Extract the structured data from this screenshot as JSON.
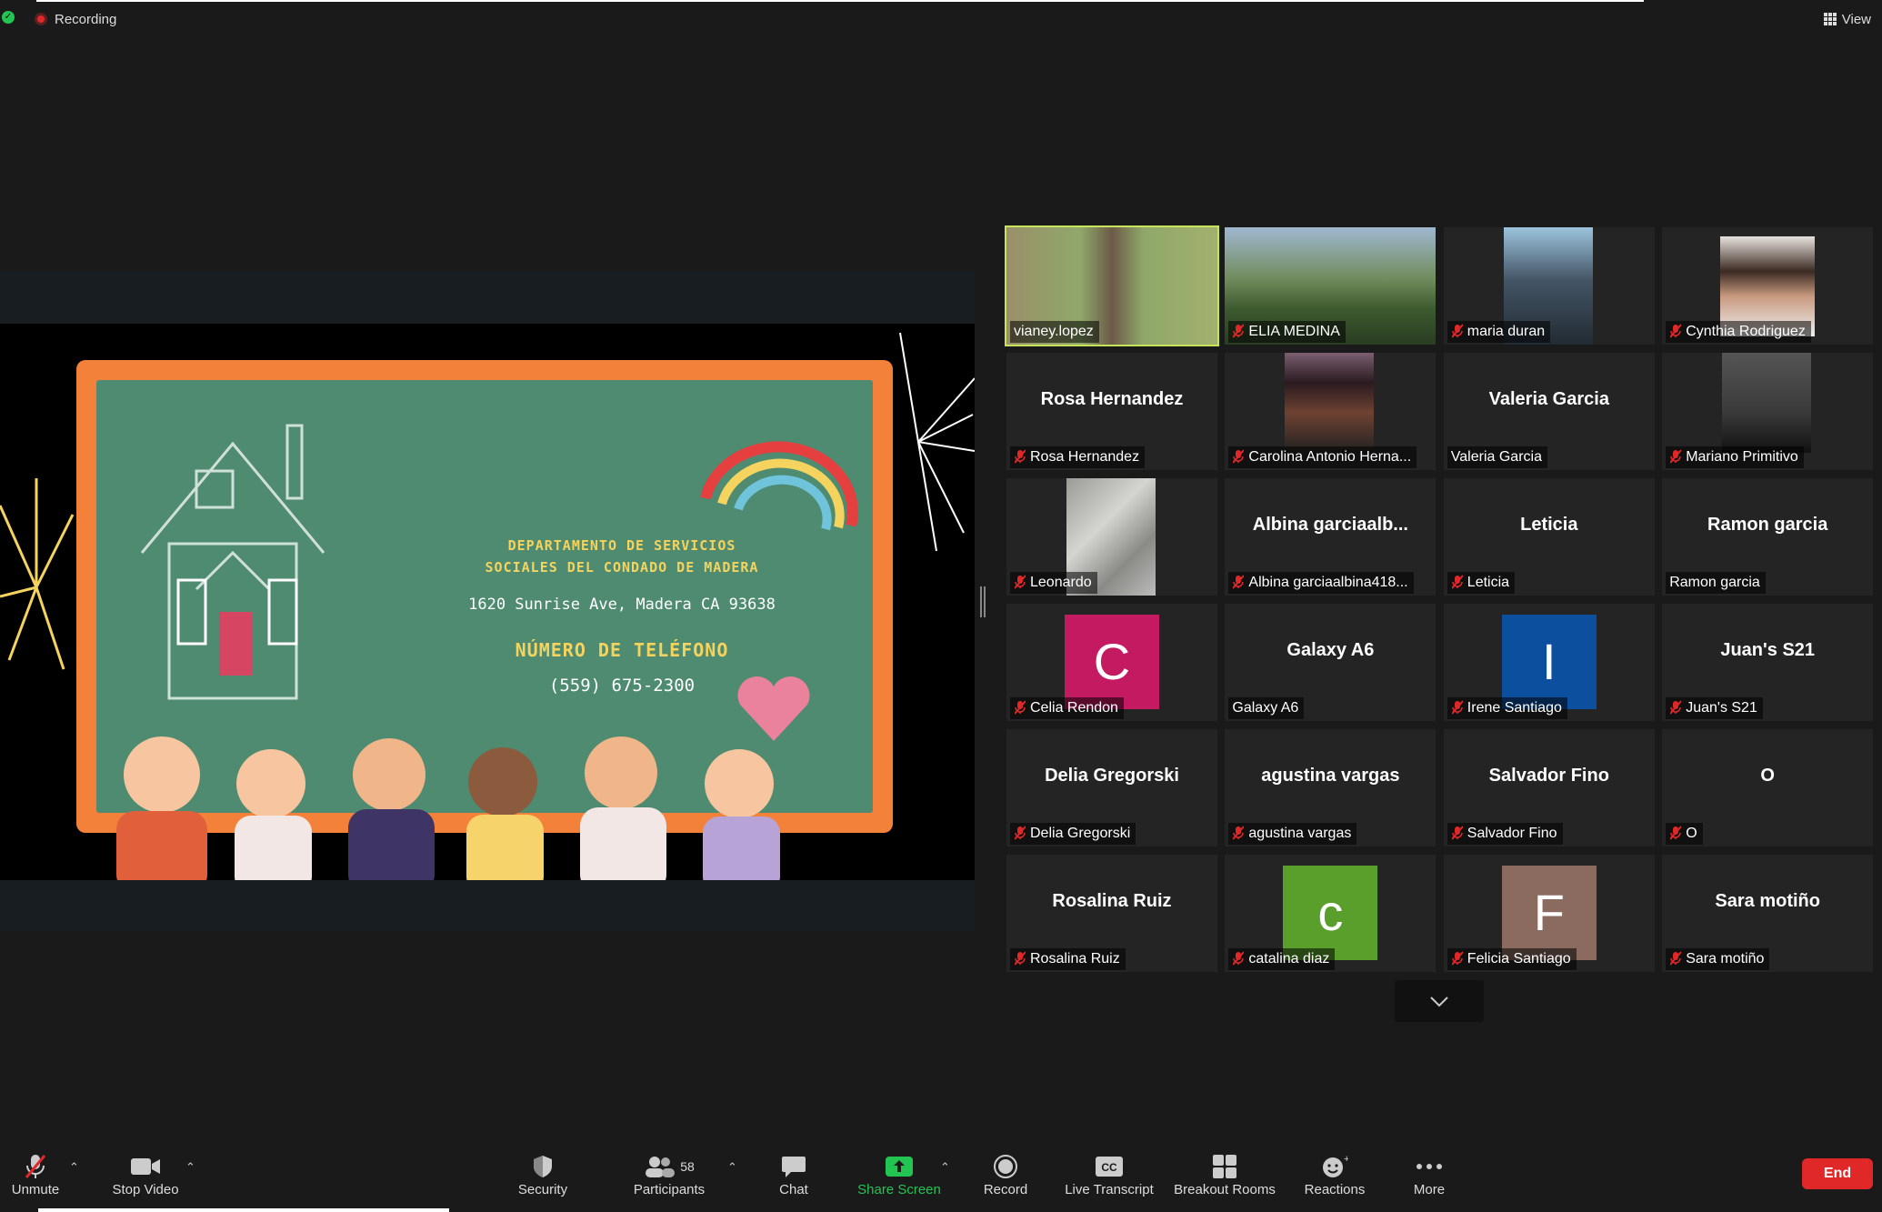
{
  "topbar": {
    "recording_label": "Recording",
    "view_label": "View"
  },
  "slide": {
    "dept_line1": "DEPARTAMENTO DE SERVICIOS",
    "dept_line2": "SOCIALES DEL CONDADO DE MADERA",
    "address": "1620 Sunrise Ave, Madera CA 93638",
    "phone_label": "NÚMERO DE TELÉFONO",
    "phone": "(559) 675-2300"
  },
  "participants": [
    {
      "name": "vianey.lopez",
      "muted": false,
      "active": true,
      "video": "cam-a"
    },
    {
      "name": "ELIA MEDINA",
      "muted": true,
      "video": "cam-b"
    },
    {
      "name": "maria duran",
      "muted": true,
      "video": "cam-c"
    },
    {
      "name": "Cynthia Rodriguez",
      "muted": true,
      "video": "cam-d"
    },
    {
      "name": "Rosa Hernandez",
      "muted": true,
      "big": "Rosa Hernandez"
    },
    {
      "name": "Carolina Antonio Herna...",
      "muted": true,
      "video": "cam-e"
    },
    {
      "name": "Valeria Garcia",
      "muted": false,
      "big": "Valeria Garcia"
    },
    {
      "name": "Mariano Primitivo",
      "muted": true,
      "video": "cam-f"
    },
    {
      "name": "Leonardo",
      "muted": true,
      "video": "cam-g"
    },
    {
      "name": "Albina garciaalbina418...",
      "muted": true,
      "big": "Albina  garciaalb..."
    },
    {
      "name": "Leticia",
      "muted": true,
      "big": "Leticia"
    },
    {
      "name": "Ramon garcia",
      "muted": false,
      "big": "Ramon garcia"
    },
    {
      "name": "Celia Rendon",
      "muted": true,
      "avatar": "C",
      "avatar_color": "#c41a62"
    },
    {
      "name": "Galaxy A6",
      "muted": false,
      "big": "Galaxy A6"
    },
    {
      "name": "Irene Santiago",
      "muted": true,
      "avatar": "I",
      "avatar_color": "#0b4f9e"
    },
    {
      "name": "Juan's S21",
      "muted": true,
      "big": "Juan's S21"
    },
    {
      "name": "Delia Gregorski",
      "muted": true,
      "big": "Delia Gregorski"
    },
    {
      "name": "agustina vargas",
      "muted": true,
      "big": "agustina vargas"
    },
    {
      "name": "Salvador Fino",
      "muted": true,
      "big": "Salvador Fino"
    },
    {
      "name": "O",
      "muted": true,
      "big": "O"
    },
    {
      "name": "Rosalina Ruiz",
      "muted": true,
      "big": "Rosalina Ruiz"
    },
    {
      "name": "catalina diaz",
      "muted": true,
      "avatar": "c",
      "avatar_color": "#5a9f2c"
    },
    {
      "name": "Felicia Santiago",
      "muted": true,
      "avatar": "F",
      "avatar_color": "#8b6b5f"
    },
    {
      "name": "Sara motiño",
      "muted": true,
      "big": "Sara motiño"
    }
  ],
  "toolbar": {
    "unmute": "Unmute",
    "stop_video": "Stop Video",
    "security": "Security",
    "participants": "Participants",
    "participants_count": "58",
    "chat": "Chat",
    "share_screen": "Share Screen",
    "record": "Record",
    "live_transcript": "Live Transcript",
    "breakout_rooms": "Breakout Rooms",
    "reactions": "Reactions",
    "more": "More",
    "end": "End"
  },
  "colors": {
    "share_green": "#23c552",
    "end_red": "#e02828",
    "active_speaker": "#c6e35b"
  }
}
